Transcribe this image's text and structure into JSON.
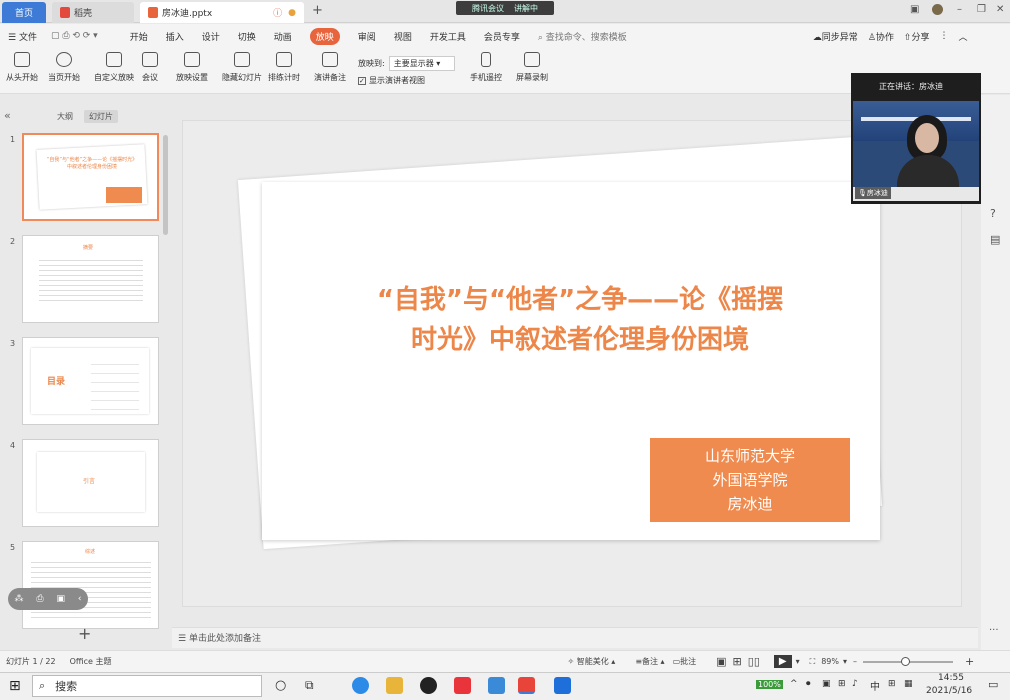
{
  "titlebar": {
    "tab_home": "首页",
    "tab_docer": "稻壳",
    "tab_file": "房冰迪.pptx",
    "meeting_label": "腾讯会议",
    "meeting_status": "讲解中"
  },
  "menu": {
    "file": "文件",
    "items": [
      "开始",
      "插入",
      "设计",
      "切换",
      "动画",
      "放映",
      "审阅",
      "视图",
      "开发工具",
      "会员专享"
    ],
    "search_placeholder": "查找命令、搜索模板",
    "sync": "同步异常",
    "collab": "协作",
    "share": "分享"
  },
  "toolbar": {
    "from_start": "从头开始",
    "from_current": "当页开始",
    "custom": "自定义放映",
    "meeting": "会议",
    "settings": "放映设置",
    "hide": "隐藏幻灯片",
    "rehearse": "排练计时",
    "notes": "演讲备注",
    "play_to_label": "放映到:",
    "play_to_value": "主要显示器",
    "presenter_view": "显示演讲者视图",
    "phone_remote": "手机遥控",
    "screen_record": "屏幕录制"
  },
  "leftpanel": {
    "outline": "大纲",
    "slides": "幻灯片",
    "thumbs": [
      {
        "num": "1",
        "text": "“自我”与“他者”之争——论《摇摆时光》中叙述者伦理身份困境"
      },
      {
        "num": "2",
        "text": "摘要"
      },
      {
        "num": "3",
        "text": "目录"
      },
      {
        "num": "4",
        "text": "引言"
      },
      {
        "num": "5",
        "text": "综述"
      }
    ]
  },
  "slide": {
    "title_line1": "“自我”与“他者”之争——论《摇摆",
    "title_line2": "时光》中叙述者伦理身份困境",
    "school": "山东师范大学",
    "college": "外国语学院",
    "author": "房冰迪"
  },
  "notes_placeholder": "单击此处添加备注",
  "video": {
    "speaking": "正在讲话：房冰迪",
    "name": "房冰迪"
  },
  "status": {
    "slide_count": "幻灯片 1 / 22",
    "theme": "Office 主题",
    "beautify": "智能美化",
    "notes": "备注",
    "comments": "批注",
    "zoom": "89%"
  },
  "taskbar": {
    "search": "搜索",
    "battery": "100%",
    "ime": "中",
    "time": "14:55",
    "date": "2021/5/16"
  },
  "colors": {
    "accent_orange": "#ef8b4f",
    "wps_blue": "#3d7bd6"
  }
}
